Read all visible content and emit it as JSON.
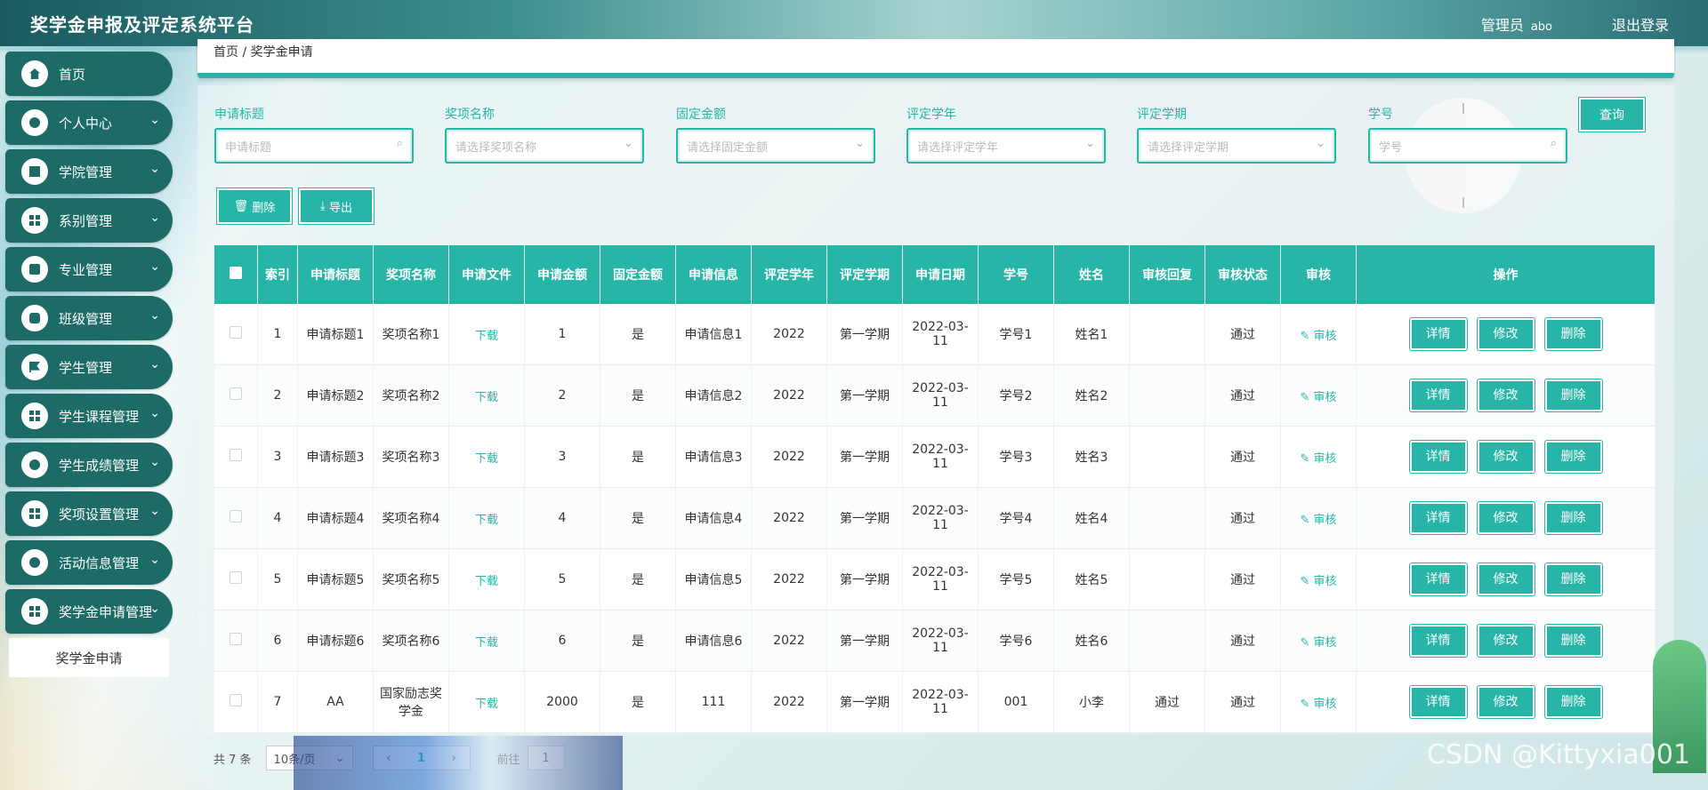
{
  "header": {
    "title": "奖学金申报及评定系统平台",
    "admin_label": "管理员",
    "admin_name": "abo",
    "logout": "退出登录"
  },
  "sidebar": {
    "items": [
      {
        "label": "首页",
        "icon": "home-icon"
      },
      {
        "label": "个人中心",
        "icon": "user-icon"
      },
      {
        "label": "学院管理",
        "icon": "building-icon"
      },
      {
        "label": "系别管理",
        "icon": "grid-icon"
      },
      {
        "label": "专业管理",
        "icon": "briefcase-icon"
      },
      {
        "label": "班级管理",
        "icon": "chat-icon"
      },
      {
        "label": "学生管理",
        "icon": "flag-icon"
      },
      {
        "label": "学生课程管理",
        "icon": "grid-icon"
      },
      {
        "label": "学生成绩管理",
        "icon": "user-icon"
      },
      {
        "label": "奖项设置管理",
        "icon": "apps-icon"
      },
      {
        "label": "活动信息管理",
        "icon": "user-card-icon"
      },
      {
        "label": "奖学金申请管理",
        "icon": "grid-icon"
      }
    ],
    "active_sub": "奖学金申请"
  },
  "breadcrumb": {
    "home": "首页",
    "sep": "/",
    "current": "奖学金申请"
  },
  "search": {
    "fields": [
      {
        "label": "申请标题",
        "placeholder": "申请标题"
      },
      {
        "label": "奖项名称",
        "placeholder": "请选择奖项名称"
      },
      {
        "label": "固定金额",
        "placeholder": "请选择固定金额"
      },
      {
        "label": "评定学年",
        "placeholder": "请选择评定学年"
      },
      {
        "label": "评定学期",
        "placeholder": "请选择评定学期"
      },
      {
        "label": "学号",
        "placeholder": "学号"
      }
    ],
    "query_button": "查询"
  },
  "actions": {
    "delete": "删除",
    "export": "导出"
  },
  "table": {
    "headers": [
      "索引",
      "申请标题",
      "奖项名称",
      "申请文件",
      "申请金额",
      "固定金额",
      "申请信息",
      "评定学年",
      "评定学期",
      "申请日期",
      "学号",
      "姓名",
      "审核回复",
      "审核状态",
      "审核",
      "操作"
    ],
    "rows": [
      {
        "idx": "1",
        "title": "申请标题1",
        "award": "奖项名称1",
        "file": "下载",
        "amount": "1",
        "fixed": "是",
        "info": "申请信息1",
        "year": "2022",
        "term": "第一学期",
        "date": "2022-03-11",
        "sid": "学号1",
        "name": "姓名1",
        "reply": "",
        "status": "通过",
        "audit": "审核"
      },
      {
        "idx": "2",
        "title": "申请标题2",
        "award": "奖项名称2",
        "file": "下载",
        "amount": "2",
        "fixed": "是",
        "info": "申请信息2",
        "year": "2022",
        "term": "第一学期",
        "date": "2022-03-11",
        "sid": "学号2",
        "name": "姓名2",
        "reply": "",
        "status": "通过",
        "audit": "审核"
      },
      {
        "idx": "3",
        "title": "申请标题3",
        "award": "奖项名称3",
        "file": "下载",
        "amount": "3",
        "fixed": "是",
        "info": "申请信息3",
        "year": "2022",
        "term": "第一学期",
        "date": "2022-03-11",
        "sid": "学号3",
        "name": "姓名3",
        "reply": "",
        "status": "通过",
        "audit": "审核"
      },
      {
        "idx": "4",
        "title": "申请标题4",
        "award": "奖项名称4",
        "file": "下载",
        "amount": "4",
        "fixed": "是",
        "info": "申请信息4",
        "year": "2022",
        "term": "第一学期",
        "date": "2022-03-11",
        "sid": "学号4",
        "name": "姓名4",
        "reply": "",
        "status": "通过",
        "audit": "审核"
      },
      {
        "idx": "5",
        "title": "申请标题5",
        "award": "奖项名称5",
        "file": "下载",
        "amount": "5",
        "fixed": "是",
        "info": "申请信息5",
        "year": "2022",
        "term": "第一学期",
        "date": "2022-03-11",
        "sid": "学号5",
        "name": "姓名5",
        "reply": "",
        "status": "通过",
        "audit": "审核"
      },
      {
        "idx": "6",
        "title": "申请标题6",
        "award": "奖项名称6",
        "file": "下载",
        "amount": "6",
        "fixed": "是",
        "info": "申请信息6",
        "year": "2022",
        "term": "第一学期",
        "date": "2022-03-11",
        "sid": "学号6",
        "name": "姓名6",
        "reply": "",
        "status": "通过",
        "audit": "审核"
      },
      {
        "idx": "7",
        "title": "AA",
        "award": "国家励志奖学金",
        "file": "下载",
        "amount": "2000",
        "fixed": "是",
        "info": "111",
        "year": "2022",
        "term": "第一学期",
        "date": "2022-03-11",
        "sid": "001",
        "name": "小李",
        "reply": "通过",
        "status": "通过",
        "audit": "审核"
      }
    ],
    "row_ops": {
      "detail": "详情",
      "edit": "修改",
      "delete": "删除"
    }
  },
  "pagination": {
    "total": "共 7 条",
    "page_size": "10条/页",
    "current": "1",
    "goto": "前往",
    "goto_value": "1"
  },
  "watermark": "CSDN @Kittyxia001",
  "colors": {
    "accent": "#26b5a6",
    "sidebar": "#1d6b66"
  }
}
